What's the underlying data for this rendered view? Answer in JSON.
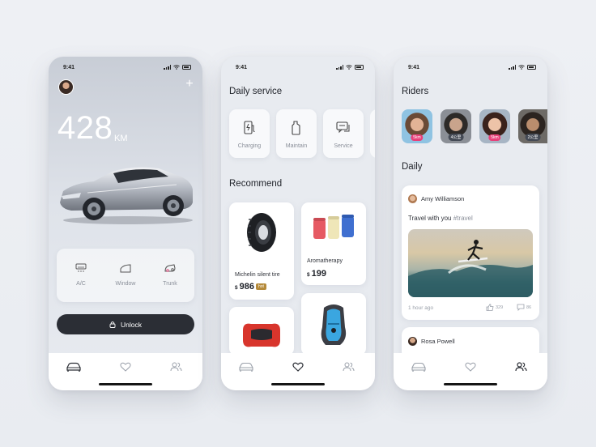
{
  "phone1": {
    "status_time": "9:41",
    "distance_value": "428",
    "distance_unit": "KM",
    "controls": [
      {
        "label": "A/C",
        "icon": "ac-icon"
      },
      {
        "label": "Window",
        "icon": "window-icon"
      },
      {
        "label": "Trunk",
        "icon": "trunk-icon"
      }
    ],
    "unlock_label": "Unlock"
  },
  "phone2": {
    "status_time": "9:41",
    "daily_service_title": "Daily service",
    "services": [
      {
        "label": "Charging",
        "icon": "charging-icon"
      },
      {
        "label": "Maintain",
        "icon": "maintain-icon"
      },
      {
        "label": "Service",
        "icon": "service-icon"
      }
    ],
    "recommend_title": "Recommend",
    "products": [
      {
        "name": "Michelin silent tire",
        "currency": "$",
        "price": "986",
        "tag": "hot"
      },
      {
        "name": "Aromatherapy",
        "currency": "$",
        "price": "199"
      }
    ]
  },
  "phone3": {
    "status_time": "9:41",
    "riders_title": "Riders",
    "riders": [
      {
        "tag": "5km",
        "tag_color": "#e8417a"
      },
      {
        "tag": "4公里",
        "tag_color": "#444a55"
      },
      {
        "tag": "5km",
        "tag_color": "#e8417a"
      },
      {
        "tag": "2公里",
        "tag_color": "#444a55"
      }
    ],
    "daily_title": "Daily",
    "post": {
      "user": "Amy Williamson",
      "text": "Travel with you ",
      "hashtag": "#travel",
      "time": "1 hour ago",
      "likes": "329",
      "comments": "86"
    },
    "post2_user": "Rosa Powell"
  },
  "colors": {
    "dark_button": "#2b2e35",
    "card_bg": "#ffffff",
    "screen_bg": "#e8ebf0"
  }
}
